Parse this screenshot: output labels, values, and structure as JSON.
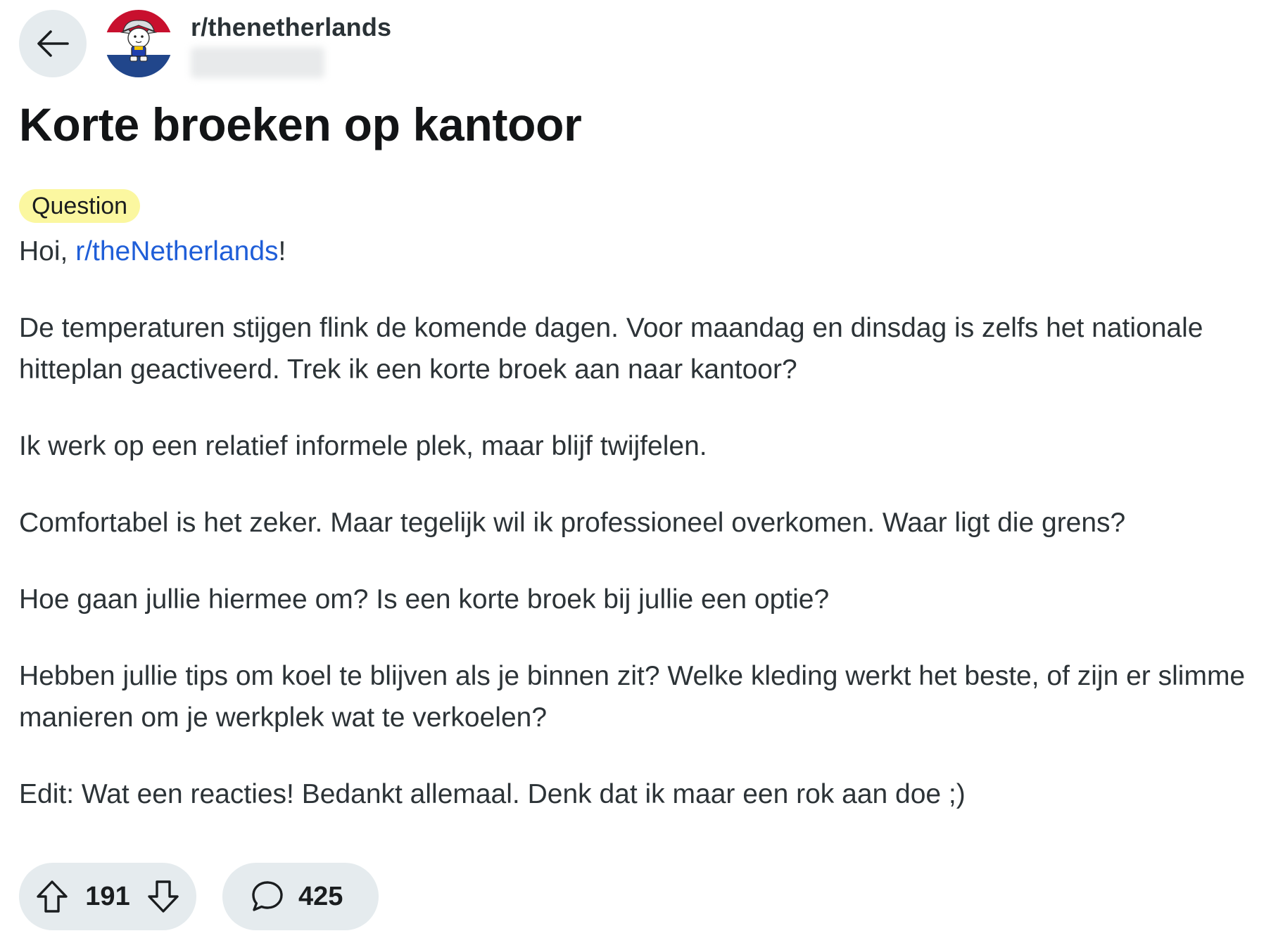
{
  "header": {
    "back_icon": "arrow-left-icon",
    "subreddit": "r/thenetherlands",
    "avatar_icon": "dutch-flag-mascot-icon"
  },
  "post": {
    "title": "Korte broeken op kantoor",
    "flair": "Question",
    "greeting_prefix": "Hoi, ",
    "greeting_link": "r/theNetherlands",
    "greeting_suffix": "!",
    "paragraphs": [
      "De temperaturen stijgen flink de komende dagen. Voor maandag en dinsdag is zelfs het nationale hitteplan geactiveerd. Trek ik een korte broek aan naar kantoor?",
      "Ik werk op een relatief informele plek, maar blijf twijfelen.",
      "Comfortabel is het zeker. Maar tegelijk wil ik professioneel overkomen. Waar ligt die grens?",
      "Hoe gaan jullie hiermee om? Is een korte broek bij jullie een optie?",
      "Hebben jullie tips om koel te blijven als je binnen zit? Welke kleding werkt het beste, of zijn er slimme manieren om je werkplek wat te verkoelen?",
      "Edit: Wat een reacties! Bedankt allemaal. Denk dat ik maar een rok aan doe ;)"
    ]
  },
  "actions": {
    "upvote_icon": "upvote-arrow-icon",
    "downvote_icon": "downvote-arrow-icon",
    "comment_icon": "comment-bubble-icon",
    "score": "191",
    "comments": "425"
  },
  "colors": {
    "link": "#1f5ed8",
    "flair_bg": "#fbf7a0",
    "pill_bg": "#e5ebee",
    "flag_red": "#c8102e",
    "flag_blue": "#21468b"
  }
}
